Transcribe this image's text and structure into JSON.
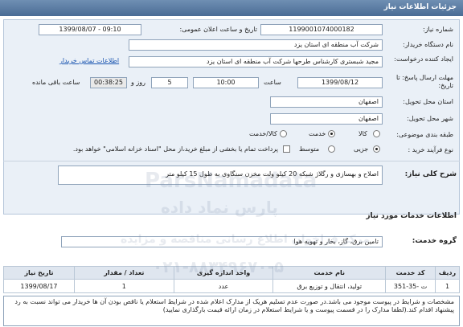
{
  "header": {
    "title": "جزئیات اطلاعات نیاز"
  },
  "form": {
    "need_number_label": "شماره نیاز:",
    "need_number": "1199001074000182",
    "announce_label": "تاریخ و ساعت اعلان عمومی:",
    "announce_value": "1399/08/07 - 09:10",
    "buyer_label": "نام دستگاه خریدار:",
    "buyer_value": "شرکت آب منطقه ای استان یزد",
    "creator_label": "ایجاد کننده درخواست:",
    "creator_value": "مجید شبستری کارشناس طرحها شرکت آب منطقه ای استان یزد",
    "contact_link": "اطلاعات تماس خریدار",
    "deadline_label": "مهلت ارسال پاسخ: تا تاریخ:",
    "deadline_date": "1399/08/12",
    "time_label": "ساعت",
    "deadline_time": "10:00",
    "day_count": "5",
    "day_label": "روز و",
    "remaining_time": "00:38:25",
    "remaining_label": "ساعت باقی مانده",
    "province_label": "استان محل تحویل:",
    "province_value": "اصفهان",
    "city_label": "شهر محل تحویل:",
    "city_value": "اصفهان",
    "category_label": "طبقه بندی موضوعی:",
    "category_options": [
      "کالا",
      "خدمت",
      "کالا/خدمت"
    ],
    "category_selected": "خدمت",
    "process_label": "نوع فرآیند خرید :",
    "process_options": [
      "جزیی",
      "متوسط"
    ],
    "process_selected": "جزیی",
    "payment_text": "پرداخت تمام یا بخشی از مبلغ خرید،از محل \"اسناد خزانه اسلامی\" خواهد بود."
  },
  "description": {
    "label": "شرح کلی نیاز:",
    "text": "اصلاح و بهسازی و رگلاژ شبکه 20 کیلو ولت مخزن سنگاوی به طول 15 کیلو متر"
  },
  "services": {
    "title": "اطلاعات خدمات مورد نیاز",
    "group_label": "گروه خدمت:",
    "group_value": "تامین برق، گاز، بخار و تهویه هوا"
  },
  "table": {
    "headers": [
      "ردیف",
      "کد خدمت",
      "نام خدمت",
      "واحد اندازه گیری",
      "تعداد / مقدار",
      "تاریخ نیاز"
    ],
    "rows": [
      [
        "1",
        "ت -35-351",
        "تولید، انتقال و توزیع برق",
        "عدد",
        "1",
        "1399/08/17"
      ]
    ]
  },
  "notes": {
    "text": "مشخصات و شرایط در پیوست موجود می باشد.در صورت عدم تسلیم هریک از مدارک اعلام شده در شرایط استعلام یا ناقص بودن آن ها خریدار می تواند نسبت به رد پیشنهاد اقدام کند.(لطفا مدارک را در قسمت پیوست و یا شرایط استعلام در زمان ارائه قیمت بارگذاری نمایید)"
  },
  "watermark": {
    "line1": "ParsNamadata",
    "line2": "پارس نماد داده",
    "line3": "مرکز فراخوان اطلاع رسانی مناقصه و مزایده",
    "line4": "۰۲۱-۸۸۳۴۹۶۷۰-۵"
  }
}
